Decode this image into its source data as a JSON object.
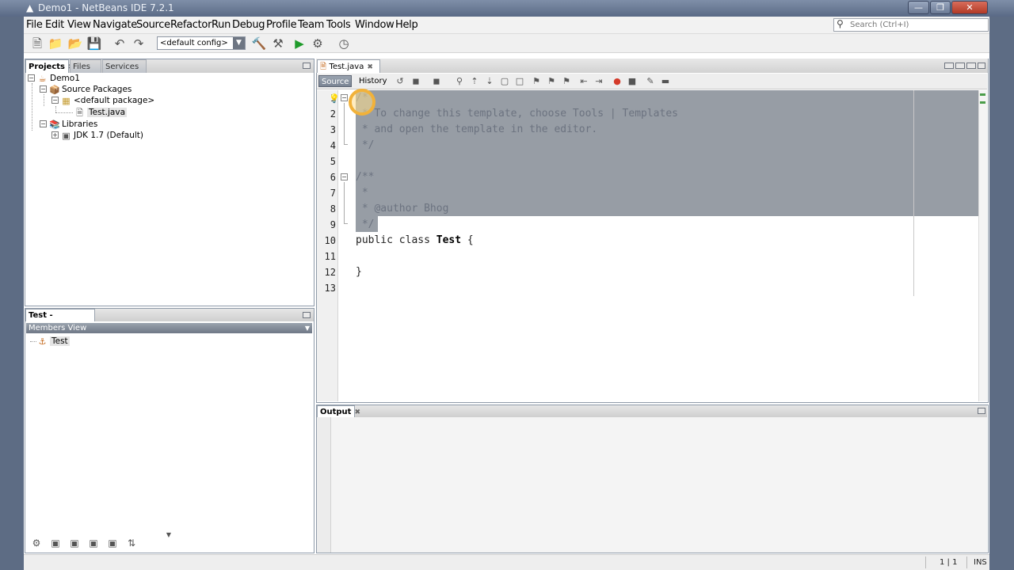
{
  "window": {
    "title": "Demo1 - NetBeans IDE 7.2.1",
    "controls": [
      "minimize",
      "maximize",
      "close"
    ]
  },
  "menu": [
    "File",
    "Edit",
    "View",
    "Navigate",
    "Source",
    "Refactor",
    "Run",
    "Debug",
    "Profile",
    "Team",
    "Tools",
    "Window",
    "Help"
  ],
  "search": {
    "placeholder": "Search (Ctrl+I)"
  },
  "toolbar": {
    "config": "<default config>"
  },
  "projects_panel": {
    "tabs": [
      "Projects",
      "Files",
      "Services"
    ],
    "tree": {
      "project": "Demo1",
      "source_packages": "Source Packages",
      "default_package": "<default package>",
      "file": "Test.java",
      "libraries": "Libraries",
      "jdk": "JDK 1.7 (Default)"
    }
  },
  "navigator_panel": {
    "tab": "Test - Navigator",
    "view": "Members View",
    "item": "Test"
  },
  "editor": {
    "tab": "Test.java",
    "modes": [
      "Source",
      "History"
    ],
    "line_numbers": [
      "1",
      "2",
      "3",
      "4",
      "5",
      "6",
      "7",
      "8",
      "9",
      "10",
      "11",
      "12",
      "13"
    ],
    "lines": [
      "/*",
      " * To change this template, choose Tools | Templates",
      " * and open the template in the editor.",
      " */",
      "",
      "/**",
      " *",
      " * @author Bhog",
      " */",
      "public class Test {",
      "",
      "}",
      ""
    ],
    "class_keyword": "public class ",
    "class_name": "Test",
    "class_brace": " {",
    "closing_brace": "}"
  },
  "output_panel": {
    "tab": "Output"
  },
  "status": {
    "position": "1 | 1",
    "mode": "INS"
  }
}
